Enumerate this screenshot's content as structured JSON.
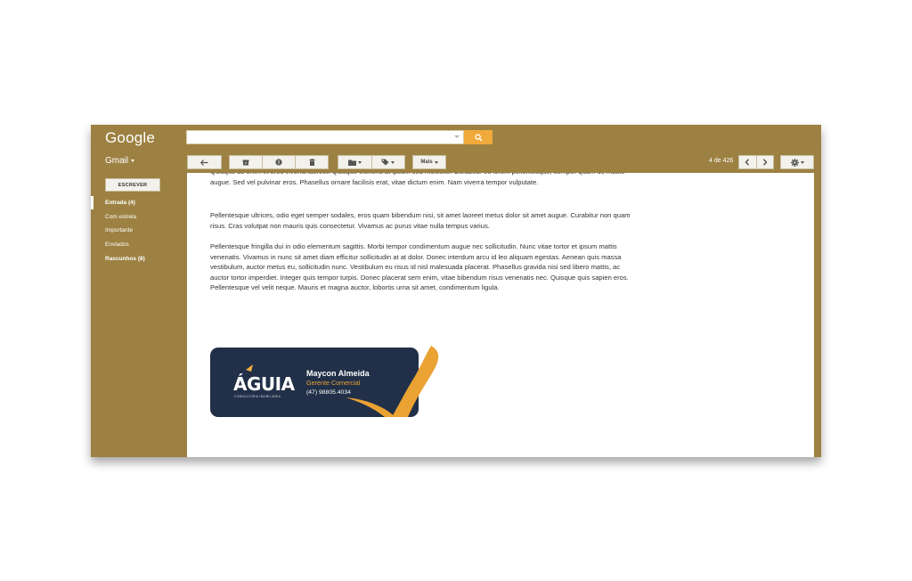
{
  "header": {
    "logo": "Google",
    "search": {
      "value": "",
      "placeholder": ""
    },
    "app_menu_label": "Gmail"
  },
  "toolbar": {
    "more_label": "Mais",
    "page_count": "4 de 426"
  },
  "sidebar": {
    "compose_label": "ESCREVER",
    "items": [
      {
        "label": "Entrada (4)",
        "bold": true,
        "active": true
      },
      {
        "label": "Com estrela",
        "bold": false
      },
      {
        "label": "Importante",
        "bold": false
      },
      {
        "label": "Enviados",
        "bold": false
      },
      {
        "label": "Rascunhos (8)",
        "bold": true
      }
    ]
  },
  "email": {
    "paragraphs": [
      "Quisque ac enim et eros viverra laoreet. Quisque eleifend at ipsum sed molestie. Curabitur eu lorem pellentesque, semper quam ut, mattis augue. Sed vel pulvinar eros. Phasellus ornare facilisis erat, vitae dictum enim. Nam viverra tempor vulputate.",
      "Pellentesque ultrices, odio eget semper sodales, eros quam bibendum nisi, sit amet laoreet metus dolor sit amet augue. Curabitur non quam risus. Cras volutpat non mauris quis consectetur. Vivamus ac purus vitae nulla tempus varius.",
      "Pellentesque fringilla dui in odio elementum sagittis. Morbi tempor condimentum augue nec sollicitudin. Nunc vitae tortor et ipsum mattis venenatis. Vivamus in nunc sit amet diam efficitur sollicitudin at at dolor. Donec interdum arcu id leo aliquam egestas. Aenean quis massa vestibulum, auctor metus eu, sollicitudin nunc. Vestibulum eu risus id nisl malesuada placerat. Phasellus gravida nisi sed libero mattis, ac auctor tortor imperdiet. Integer quis tempor turpis. Donec placerat sem enim, vitae bibendum risus venenatis nec. Quisque quis sapien eros. Pellentesque vel velit neque. Mauris et magna auctor, lobortis urna sit amet, condimentum ligula."
    ]
  },
  "signature": {
    "brand": "ÁGUIA",
    "brand_tagline": "CONSULTORIA IMOBILIÁRIA",
    "name": "Maycon Almeida",
    "role": "Gerente Comercial",
    "phone": "(47) 98805.4034"
  },
  "colors": {
    "chrome": "#9d8142",
    "accent": "#f0a93b",
    "signature_bg": "#213048"
  }
}
